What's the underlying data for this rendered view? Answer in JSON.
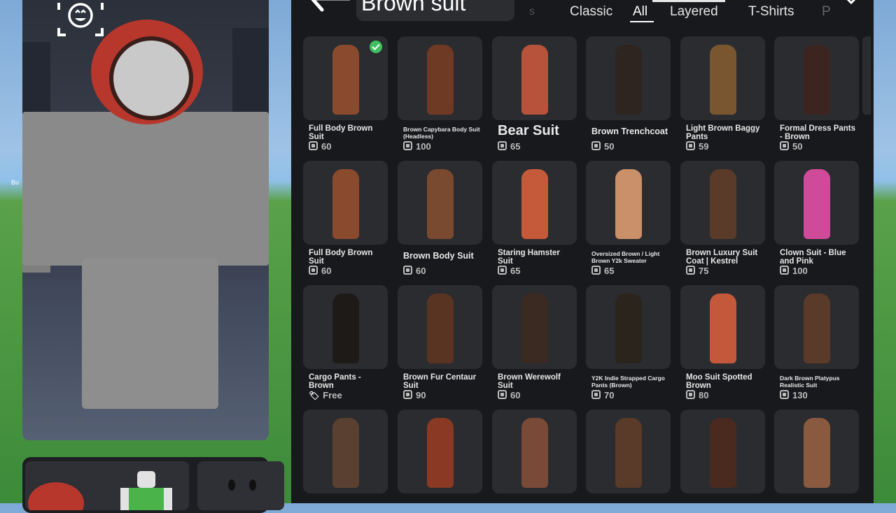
{
  "search": {
    "query": "Brown suit",
    "ghost": "s"
  },
  "tabs": [
    {
      "label": "Classic"
    },
    {
      "label": "All"
    },
    {
      "label": "Layered"
    },
    {
      "label": "T-Shirts"
    },
    {
      "label": "P"
    }
  ],
  "active_tab": "All",
  "viewport": {
    "side_label": "Bu"
  },
  "items": [
    {
      "name": "Full Body Brown Suit",
      "price": "60",
      "owned": true
    },
    {
      "name": "Brown Capybara Body Suit (Headless)",
      "price": "100"
    },
    {
      "name": "Bear Suit",
      "price": "65"
    },
    {
      "name": "Brown Trenchcoat",
      "price": "50"
    },
    {
      "name": "Light Brown Baggy Pants",
      "price": "59"
    },
    {
      "name": "Formal Dress Pants - Brown",
      "price": "50"
    },
    {
      "name": "Full Body Brown Suit",
      "price": "60"
    },
    {
      "name": "Brown Body Suit",
      "price": "60"
    },
    {
      "name": "Staring Hamster Suit",
      "price": "65"
    },
    {
      "name": "Oversized Brown / Light Brown Y2k Sweater",
      "price": "65"
    },
    {
      "name": "Brown Luxury Suit Coat | Kestrel",
      "price": "75"
    },
    {
      "name": "Clown Suit - Blue and Pink",
      "price": "100"
    },
    {
      "name": "Cargo Pants - Brown",
      "price": "Free"
    },
    {
      "name": "Brown Fur Centaur Suit",
      "price": "90"
    },
    {
      "name": "Brown Werewolf Suit",
      "price": "60"
    },
    {
      "name": "Y2K Indie Strapped Cargo Pants (Brown)",
      "price": "70"
    },
    {
      "name": "Moo Suit Spotted Brown",
      "price": "80"
    },
    {
      "name": "Dark Brown Platypus Realistic Suit",
      "price": "130"
    },
    {
      "name": "",
      "price": ""
    },
    {
      "name": "",
      "price": ""
    },
    {
      "name": "",
      "price": ""
    },
    {
      "name": "",
      "price": ""
    },
    {
      "name": "",
      "price": ""
    },
    {
      "name": "",
      "price": ""
    }
  ],
  "colors": {
    "panel": "#18191c",
    "card": "#2b2c30",
    "owned_badge": "#3fbf5f",
    "text": "#e8e8e8",
    "price": "#bdbdbd"
  }
}
